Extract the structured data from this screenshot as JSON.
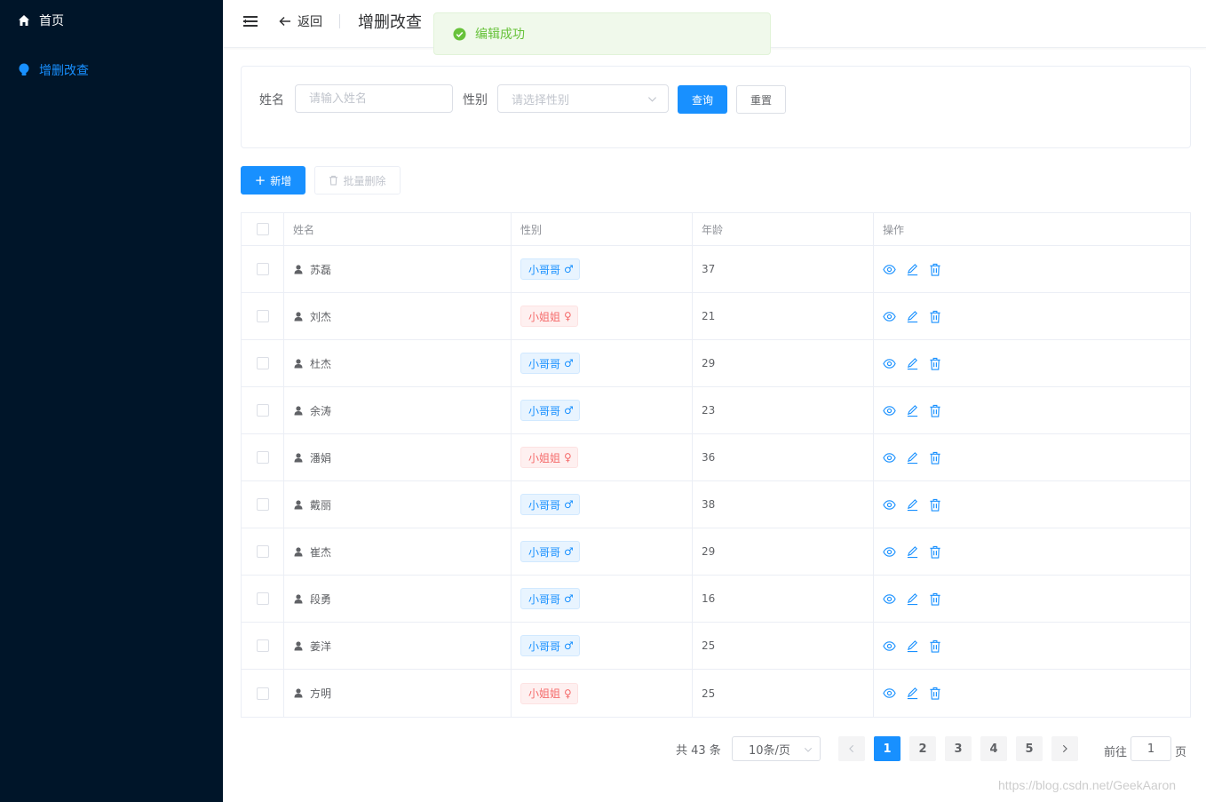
{
  "sidebar": {
    "items": [
      {
        "label": "首页",
        "icon": "home-icon",
        "active": false
      },
      {
        "label": "增删改查",
        "icon": "bulb-icon",
        "active": true
      }
    ]
  },
  "header": {
    "back_label": "返回",
    "title": "增删改查"
  },
  "toast": {
    "message": "编辑成功",
    "type": "success"
  },
  "search": {
    "name_label": "姓名",
    "name_placeholder": "请输入姓名",
    "gender_label": "性别",
    "gender_placeholder": "请选择性别",
    "query_label": "查询",
    "reset_label": "重置"
  },
  "toolbar": {
    "add_label": "新增",
    "batch_delete_label": "批量删除"
  },
  "table": {
    "columns": [
      "姓名",
      "性别",
      "年龄",
      "操作"
    ],
    "rows": [
      {
        "name": "苏磊",
        "gender": "小哥哥",
        "gender_symbol": "♂",
        "sex": "male",
        "age": "37"
      },
      {
        "name": "刘杰",
        "gender": "小姐姐",
        "gender_symbol": "♀",
        "sex": "female",
        "age": "21"
      },
      {
        "name": "杜杰",
        "gender": "小哥哥",
        "gender_symbol": "♂",
        "sex": "male",
        "age": "29"
      },
      {
        "name": "余涛",
        "gender": "小哥哥",
        "gender_symbol": "♂",
        "sex": "male",
        "age": "23"
      },
      {
        "name": "潘娟",
        "gender": "小姐姐",
        "gender_symbol": "♀",
        "sex": "female",
        "age": "36"
      },
      {
        "name": "戴丽",
        "gender": "小哥哥",
        "gender_symbol": "♂",
        "sex": "male",
        "age": "38"
      },
      {
        "name": "崔杰",
        "gender": "小哥哥",
        "gender_symbol": "♂",
        "sex": "male",
        "age": "29"
      },
      {
        "name": "段勇",
        "gender": "小哥哥",
        "gender_symbol": "♂",
        "sex": "male",
        "age": "16"
      },
      {
        "name": "姜洋",
        "gender": "小哥哥",
        "gender_symbol": "♂",
        "sex": "male",
        "age": "25"
      },
      {
        "name": "方明",
        "gender": "小姐姐",
        "gender_symbol": "♀",
        "sex": "female",
        "age": "25"
      }
    ]
  },
  "pagination": {
    "total_label": "共 43 条",
    "page_size": "10条/页",
    "pages": [
      "1",
      "2",
      "3",
      "4",
      "5"
    ],
    "current_page": "1",
    "goto_label": "前往",
    "goto_value": "1",
    "page_suffix": "页"
  },
  "watermark": "https://blog.csdn.net/GeekAaron",
  "colors": {
    "sidebar_bg": "#001529",
    "primary": "#1890ff",
    "success": "#67c23a",
    "danger": "#f56c6c"
  }
}
